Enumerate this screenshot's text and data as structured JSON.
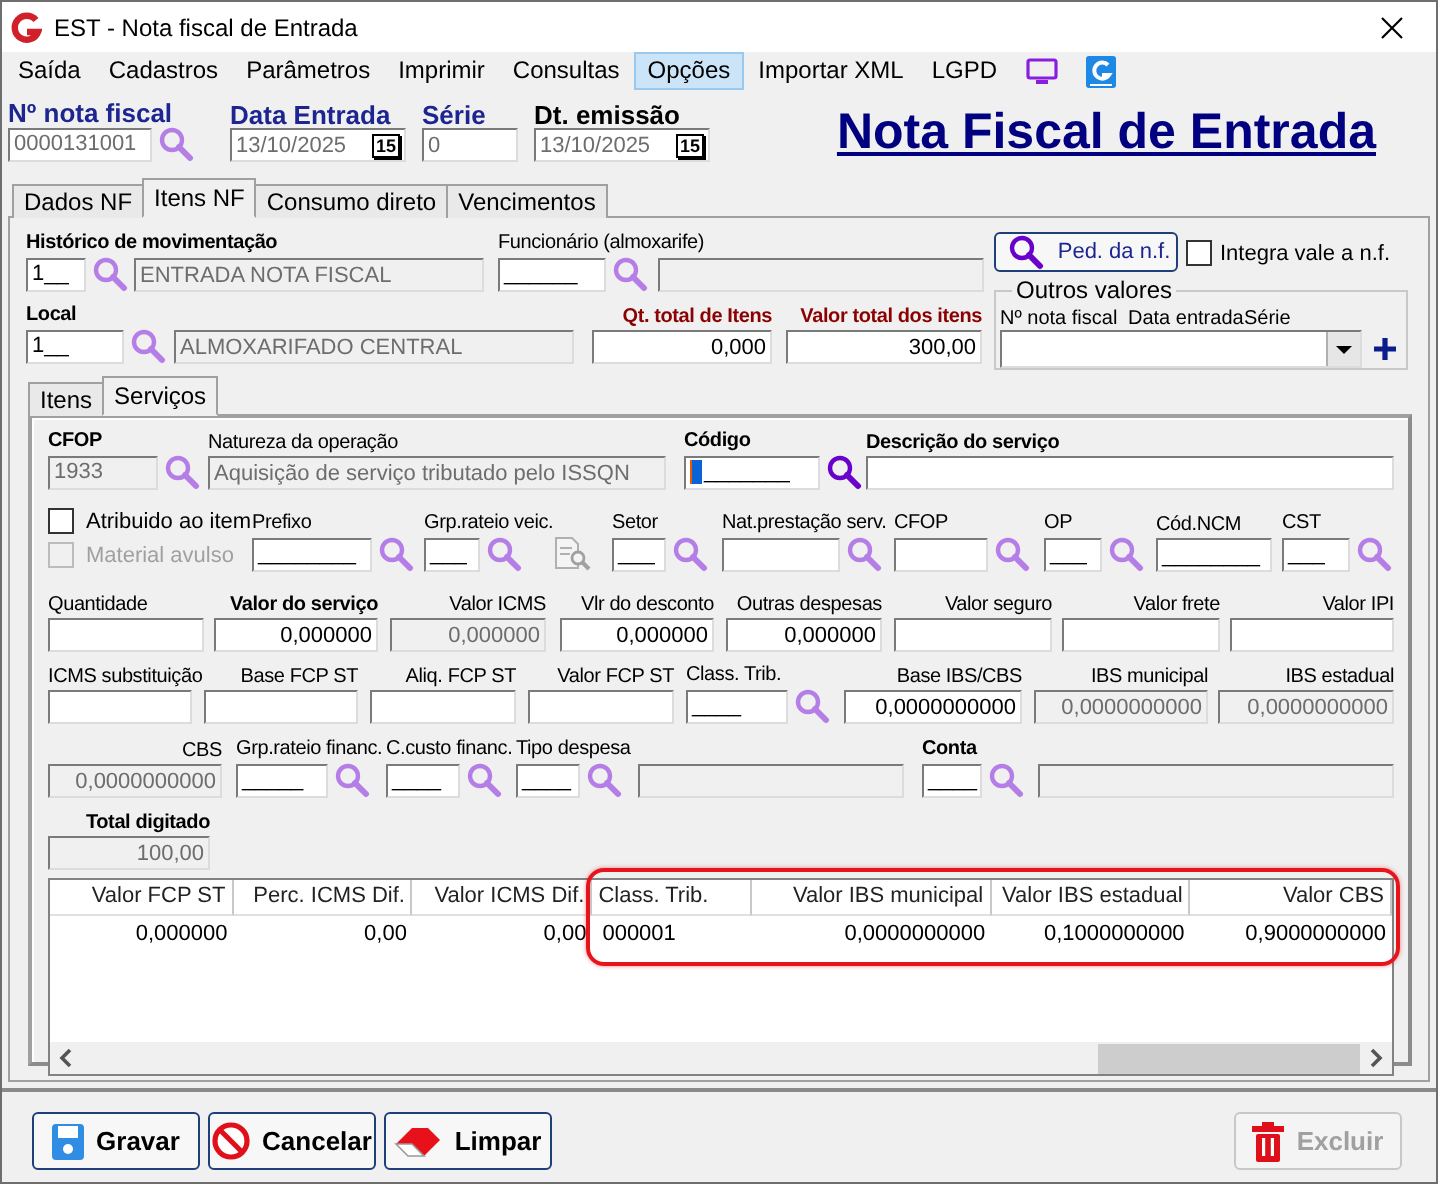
{
  "window": {
    "title": "EST - Nota fiscal de Entrada"
  },
  "menu": [
    {
      "kind": "text",
      "label": "Saída",
      "selected": false
    },
    {
      "kind": "text",
      "label": "Cadastros",
      "selected": false
    },
    {
      "kind": "text",
      "label": "Parâmetros",
      "selected": false
    },
    {
      "kind": "text",
      "label": "Imprimir",
      "selected": false
    },
    {
      "kind": "text",
      "label": "Consultas",
      "selected": false
    },
    {
      "kind": "text",
      "label": "Opções",
      "selected": true
    },
    {
      "kind": "text",
      "label": "Importar XML",
      "selected": false
    },
    {
      "kind": "text",
      "label": "LGPD",
      "selected": false
    },
    {
      "kind": "monitor",
      "selected": false
    },
    {
      "kind": "logo",
      "selected": false
    }
  ],
  "header": {
    "title": "Nota Fiscal de Entrada",
    "fields": [
      {
        "label": "Nº nota fiscal",
        "bold": true,
        "color": "#1c2590",
        "value": "0000131001",
        "kind": "text",
        "lookup": true,
        "disabled": false,
        "focused": false
      },
      {
        "label": "Data Entrada",
        "bold": true,
        "color": "#1c2590",
        "value": "13/10/2025",
        "kind": "date",
        "button": "15",
        "lookup": false,
        "disabled": false,
        "focused": false
      },
      {
        "label": "Série",
        "bold": true,
        "color": "#1c2590",
        "value": "0",
        "kind": "text",
        "lookup": false,
        "disabled": false,
        "focused": false
      },
      {
        "label": "Dt. emissão",
        "bold": true,
        "value": "13/10/2025",
        "kind": "date",
        "button": "15",
        "lookup": false,
        "disabled": false,
        "focused": false
      }
    ]
  },
  "tabs": [
    {
      "label": "Dados NF",
      "selected": false
    },
    {
      "label": "Itens NF",
      "selected": true
    },
    {
      "label": "Consumo direto",
      "selected": false
    },
    {
      "label": "Vencimentos",
      "selected": false
    }
  ],
  "itens_nf": {
    "lines": [
      {
        "fields": [
          {
            "label": "Histórico de movimentação",
            "bold": true,
            "value": "1__",
            "kind": "text",
            "lookup": true,
            "disabled": false,
            "focused": false
          },
          {
            "value": "ENTRADA NOTA FISCAL",
            "kind": "text",
            "lookup": false,
            "disabled": true,
            "focused": false
          },
          {
            "label": "Funcionário (almoxarife)",
            "bold": false,
            "value": "______",
            "kind": "text",
            "lookup": true,
            "disabled": false,
            "focused": false
          },
          {
            "kind": "text",
            "lookup": false,
            "disabled": true,
            "focused": false
          }
        ]
      },
      {
        "fields": [
          {
            "label": "Local",
            "bold": true,
            "value": "1__",
            "kind": "text",
            "lookup": true,
            "disabled": false,
            "focused": false
          },
          {
            "value": "ALMOXARIFADO CENTRAL",
            "kind": "text",
            "lookup": false,
            "disabled": true,
            "focused": false
          },
          {
            "label": "Qt. total de Itens",
            "bold": true,
            "color": "#8b0000",
            "value": "0,000",
            "kind": "number",
            "lookup": false,
            "disabled": false,
            "focused": false
          },
          {
            "label": "Valor total dos itens",
            "bold": true,
            "color": "#8b0000",
            "value": "300,00",
            "kind": "number",
            "lookup": false,
            "disabled": false,
            "focused": false
          }
        ]
      }
    ],
    "order_button": "Ped. da n.f.",
    "integra": {
      "label": "Integra vale a n.f.",
      "checked": false
    },
    "outros_valores": {
      "title": "Outros valores",
      "columns": [
        "Nº nota fiscal",
        "Data entrada",
        "Série"
      ]
    }
  },
  "subtabs": [
    {
      "label": "Itens",
      "selected": false
    },
    {
      "label": "Serviços",
      "selected": true
    }
  ],
  "servicos": {
    "checks": [
      {
        "label": "Atribuido ao item",
        "checked": false,
        "disabled": false
      },
      {
        "label": "Material avulso",
        "checked": false,
        "disabled": true
      }
    ],
    "lines": [
      {
        "fields": [
          {
            "label": "CFOP",
            "bold": true,
            "value": "1933",
            "kind": "text",
            "lookup": true,
            "disabled": true,
            "focused": false
          },
          {
            "label": "Natureza da operação",
            "bold": false,
            "value": "Aquisição de serviço tributado pelo ISSQN",
            "kind": "text",
            "lookup": false,
            "disabled": true,
            "focused": false
          },
          {
            "label": "Código",
            "bold": true,
            "value": "_______",
            "kind": "text",
            "lookup": true,
            "disabled": false,
            "focused": true
          },
          {
            "label": "Descrição do serviço",
            "bold": true,
            "kind": "text",
            "lookup": false,
            "disabled": false,
            "focused": false
          }
        ]
      },
      {
        "fields": [
          {
            "label": "Prefixo",
            "bold": false,
            "value": "________",
            "kind": "text",
            "lookup": true,
            "disabled": false,
            "focused": false
          },
          {
            "label": "Grp.rateio veic.",
            "bold": false,
            "value": "___",
            "kind": "text",
            "lookup": true,
            "disabled": false,
            "focused": false
          },
          {
            "label": "Setor",
            "bold": false,
            "value": "___",
            "kind": "text",
            "lookup": true,
            "disabled": false,
            "focused": false
          },
          {
            "label": "Nat.prestação serv.",
            "bold": false,
            "kind": "text",
            "lookup": true,
            "disabled": false,
            "focused": false
          },
          {
            "label": "CFOP",
            "bold": false,
            "kind": "text",
            "lookup": true,
            "disabled": false,
            "focused": false
          },
          {
            "label": "OP",
            "bold": false,
            "value": "___",
            "kind": "text",
            "lookup": true,
            "disabled": false,
            "focused": false
          },
          {
            "label": "Cód.NCM",
            "bold": false,
            "value": "________",
            "kind": "text",
            "lookup": false,
            "disabled": false,
            "focused": false
          },
          {
            "label": "CST",
            "bold": false,
            "value": "___",
            "kind": "text",
            "lookup": true,
            "disabled": false,
            "focused": false
          }
        ]
      },
      {
        "fields": [
          {
            "label": "Quantidade",
            "bold": false,
            "kind": "text",
            "lookup": false,
            "disabled": false,
            "focused": false
          },
          {
            "label": "Valor do serviço",
            "bold": true,
            "value": "0,000000",
            "kind": "number",
            "lookup": false,
            "disabled": false,
            "focused": false
          },
          {
            "label": "Valor ICMS",
            "bold": false,
            "value": "0,000000",
            "kind": "number",
            "lookup": false,
            "disabled": true,
            "focused": false
          },
          {
            "label": "Vlr do desconto",
            "bold": false,
            "value": "0,000000",
            "kind": "number",
            "lookup": false,
            "disabled": false,
            "focused": false
          },
          {
            "label": "Outras despesas",
            "bold": false,
            "value": "0,000000",
            "kind": "number",
            "lookup": false,
            "disabled": false,
            "focused": false
          },
          {
            "label": "Valor seguro",
            "bold": false,
            "kind": "number",
            "lookup": false,
            "disabled": false,
            "focused": false
          },
          {
            "label": "Valor frete",
            "bold": false,
            "kind": "number",
            "lookup": false,
            "disabled": false,
            "focused": false
          },
          {
            "label": "Valor IPI",
            "bold": false,
            "kind": "number",
            "lookup": false,
            "disabled": false,
            "focused": false
          }
        ]
      },
      {
        "fields": [
          {
            "label": "ICMS substituição",
            "bold": false,
            "kind": "text",
            "lookup": false,
            "disabled": false,
            "focused": false
          },
          {
            "label": "Base FCP ST",
            "bold": false,
            "kind": "number",
            "lookup": false,
            "disabled": false,
            "focused": false
          },
          {
            "label": "Aliq. FCP ST",
            "bold": false,
            "kind": "number",
            "lookup": false,
            "disabled": false,
            "focused": false
          },
          {
            "label": "Valor FCP ST",
            "bold": false,
            "kind": "number",
            "lookup": false,
            "disabled": false,
            "focused": false
          },
          {
            "label": "Class. Trib.",
            "bold": false,
            "value": "____",
            "kind": "text",
            "lookup": true,
            "disabled": false,
            "focused": false
          },
          {
            "label": "Base IBS/CBS",
            "bold": false,
            "value": "0,0000000000",
            "kind": "number",
            "lookup": false,
            "disabled": false,
            "focused": false
          },
          {
            "label": "IBS municipal",
            "bold": false,
            "value": "0,0000000000",
            "kind": "number",
            "lookup": false,
            "disabled": true,
            "focused": false
          },
          {
            "label": "IBS estadual",
            "bold": false,
            "value": "0,0000000000",
            "kind": "number",
            "lookup": false,
            "disabled": true,
            "focused": false
          }
        ]
      },
      {
        "fields": [
          {
            "label": "CBS",
            "bold": false,
            "value": "0,0000000000",
            "kind": "number",
            "lookup": false,
            "disabled": true,
            "focused": false
          },
          {
            "label": "Grp.rateio financ.",
            "bold": false,
            "value": "_____",
            "kind": "text",
            "lookup": true,
            "disabled": false,
            "focused": false
          },
          {
            "label": "C.custo financ.",
            "bold": false,
            "value": "____",
            "kind": "text",
            "lookup": true,
            "disabled": false,
            "focused": false
          },
          {
            "label": "Tipo despesa",
            "bold": false,
            "value": "____",
            "kind": "text",
            "lookup": true,
            "disabled": false,
            "focused": false
          },
          {
            "kind": "text",
            "lookup": false,
            "disabled": true,
            "focused": false
          },
          {
            "label": "Conta",
            "bold": true,
            "value": "____",
            "kind": "text",
            "lookup": true,
            "disabled": false,
            "focused": false
          },
          {
            "kind": "text",
            "lookup": false,
            "disabled": true,
            "focused": false
          }
        ]
      },
      {
        "fields": [
          {
            "label": "Total digitado",
            "bold": true,
            "value": "100,00",
            "kind": "number",
            "lookup": false,
            "disabled": true,
            "focused": false
          }
        ]
      }
    ]
  },
  "grid": {
    "columns": [
      {
        "label": "Valor FCP ST",
        "kind": "number",
        "highlighted": false
      },
      {
        "label": "Perc. ICMS Dif.",
        "kind": "number",
        "highlighted": false
      },
      {
        "label": "Valor ICMS Dif.",
        "kind": "number",
        "highlighted": false
      },
      {
        "label": "Class. Trib.",
        "kind": "text",
        "highlighted": true
      },
      {
        "label": "Valor IBS municipal",
        "kind": "number",
        "highlighted": true
      },
      {
        "label": "Valor IBS estadual",
        "kind": "number",
        "highlighted": true
      },
      {
        "label": "Valor CBS",
        "kind": "number",
        "highlighted": true
      }
    ],
    "rows": [
      [
        "0,000000",
        "0,00",
        "0,00",
        "000001",
        "0,0000000000",
        "0,1000000000",
        "0,9000000000"
      ]
    ]
  },
  "buttons": [
    {
      "label": "Gravar",
      "kind": "save",
      "disabled": false
    },
    {
      "label": "Cancelar",
      "kind": "cancel",
      "disabled": false
    },
    {
      "label": "Limpar",
      "kind": "clear",
      "disabled": false
    },
    {
      "label": "Excluir",
      "kind": "delete",
      "disabled": true
    }
  ]
}
